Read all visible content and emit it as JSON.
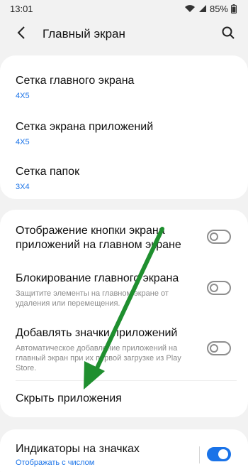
{
  "status": {
    "time": "13:01",
    "battery": "85%",
    "icons": [
      "wifi-icon",
      "signal-icon",
      "battery-icon"
    ]
  },
  "header": {
    "title": "Главный экран",
    "back_icon": "chevron-left-icon",
    "search_icon": "search-icon"
  },
  "grid_section": {
    "items": [
      {
        "title": "Сетка главного экрана",
        "value": "4X5"
      },
      {
        "title": "Сетка экрана приложений",
        "value": "4X5"
      },
      {
        "title": "Сетка папок",
        "value": "3X4"
      }
    ]
  },
  "settings_section": {
    "items": [
      {
        "title": "Отображение кнопки экрана приложений на главном экране",
        "enabled": false
      },
      {
        "title": "Блокирование главного экрана",
        "desc": "Защитите элементы на главном экране от удаления или перемещения.",
        "enabled": false
      },
      {
        "title": "Добавлять значки приложений",
        "desc": "Автоматическое добавление приложений на главный экран при их первой загрузке из Play Store.",
        "enabled": false
      },
      {
        "title": "Скрыть приложения"
      }
    ]
  },
  "badges_section": {
    "title": "Индикаторы на значках",
    "value": "Отображать с числом",
    "enabled": true
  },
  "colors": {
    "accent": "#1a73e8",
    "annotation_arrow": "#1f8f2f",
    "background": "#f2f2f2",
    "card": "#ffffff"
  }
}
